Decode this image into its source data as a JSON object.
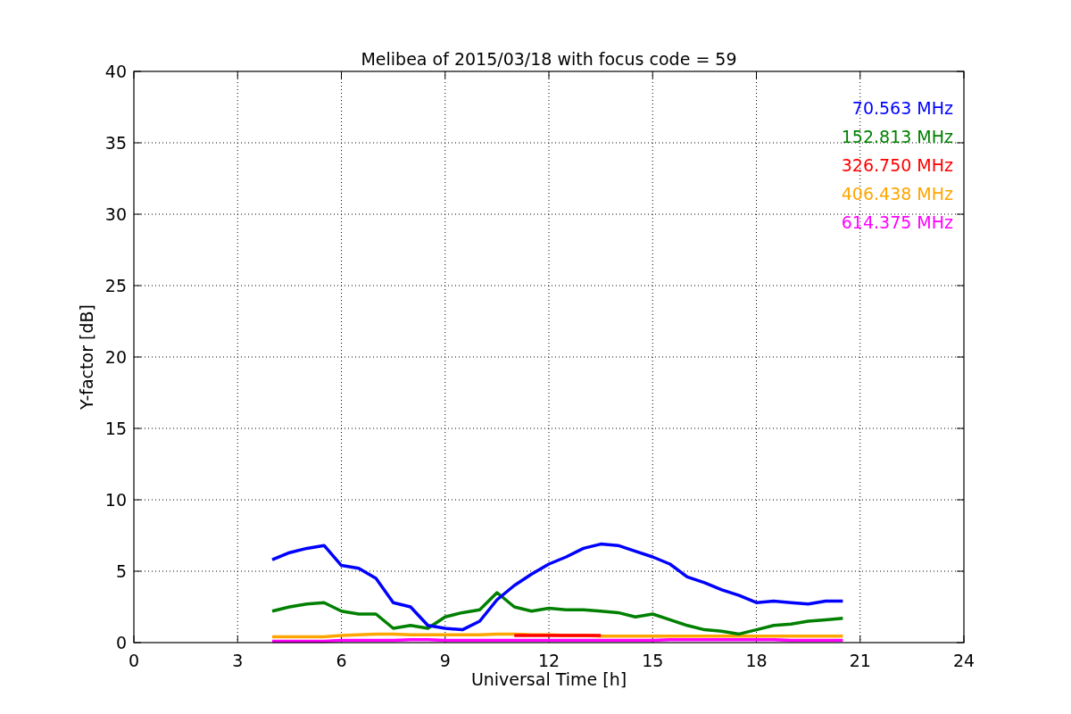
{
  "chart_data": {
    "type": "line",
    "title": "Melibea of 2015/03/18 with focus code = 59",
    "xlabel": "Universal Time [h]",
    "ylabel": "Y-factor [dB]",
    "x": [
      4,
      4.5,
      5,
      5.5,
      6,
      6.5,
      7,
      7.5,
      8,
      8.5,
      9,
      9.5,
      10,
      10.5,
      11,
      11.5,
      12,
      12.5,
      13,
      13.5,
      14,
      14.5,
      15,
      15.5,
      16,
      16.5,
      17,
      17.5,
      18,
      18.5,
      19,
      19.5,
      20,
      20.5
    ],
    "series": [
      {
        "name": "70.563 MHz",
        "color": "#0000ff",
        "values": [
          5.8,
          6.3,
          6.6,
          6.8,
          5.4,
          5.2,
          4.5,
          2.8,
          2.5,
          1.2,
          1.0,
          0.9,
          1.5,
          3.0,
          4.0,
          4.8,
          5.5,
          6.0,
          6.6,
          6.9,
          6.8,
          6.4,
          6.0,
          5.5,
          4.6,
          4.2,
          3.7,
          3.3,
          2.8,
          2.9,
          2.8,
          2.7,
          2.9,
          2.9
        ]
      },
      {
        "name": "152.813 MHz",
        "color": "#008000",
        "values": [
          2.2,
          2.5,
          2.7,
          2.8,
          2.2,
          2.0,
          2.0,
          1.0,
          1.2,
          1.0,
          1.8,
          2.1,
          2.3,
          3.5,
          2.5,
          2.2,
          2.4,
          2.3,
          2.3,
          2.2,
          2.1,
          1.8,
          2.0,
          1.6,
          1.2,
          0.9,
          0.8,
          0.6,
          0.9,
          1.2,
          1.3,
          1.5,
          1.6,
          1.7
        ]
      },
      {
        "name": "326.750 MHz",
        "color": "#ff0000",
        "values": [
          null,
          null,
          null,
          null,
          null,
          null,
          null,
          null,
          null,
          null,
          null,
          null,
          null,
          null,
          0.5,
          0.5,
          0.5,
          0.5,
          0.5,
          0.5,
          null,
          null,
          null,
          null,
          null,
          null,
          null,
          null,
          null,
          null,
          null,
          null,
          null,
          null
        ]
      },
      {
        "name": "406.438 MHz",
        "color": "#ffa500",
        "values": [
          0.4,
          0.4,
          0.4,
          0.4,
          0.5,
          0.55,
          0.6,
          0.6,
          0.55,
          0.55,
          0.55,
          0.55,
          0.55,
          0.6,
          0.6,
          0.55,
          0.55,
          0.5,
          0.5,
          0.45,
          0.45,
          0.45,
          0.45,
          0.45,
          0.45,
          0.45,
          0.45,
          0.45,
          0.45,
          0.45,
          0.45,
          0.45,
          0.45,
          0.45
        ]
      },
      {
        "name": "614.375 MHz",
        "color": "#ff00ff",
        "values": [
          0.1,
          0.1,
          0.1,
          0.1,
          0.15,
          0.15,
          0.15,
          0.15,
          0.2,
          0.2,
          0.15,
          0.15,
          0.15,
          0.15,
          0.15,
          0.15,
          0.15,
          0.15,
          0.15,
          0.15,
          0.15,
          0.15,
          0.15,
          0.2,
          0.2,
          0.2,
          0.2,
          0.2,
          0.2,
          0.2,
          0.15,
          0.15,
          0.15,
          0.15
        ]
      }
    ],
    "grid": true,
    "xlim": [
      0,
      24
    ],
    "ylim": [
      0,
      40
    ],
    "xticks": [
      0,
      3,
      6,
      9,
      12,
      15,
      18,
      21,
      24
    ],
    "yticks": [
      0,
      5,
      10,
      15,
      20,
      25,
      30,
      35,
      40
    ]
  }
}
